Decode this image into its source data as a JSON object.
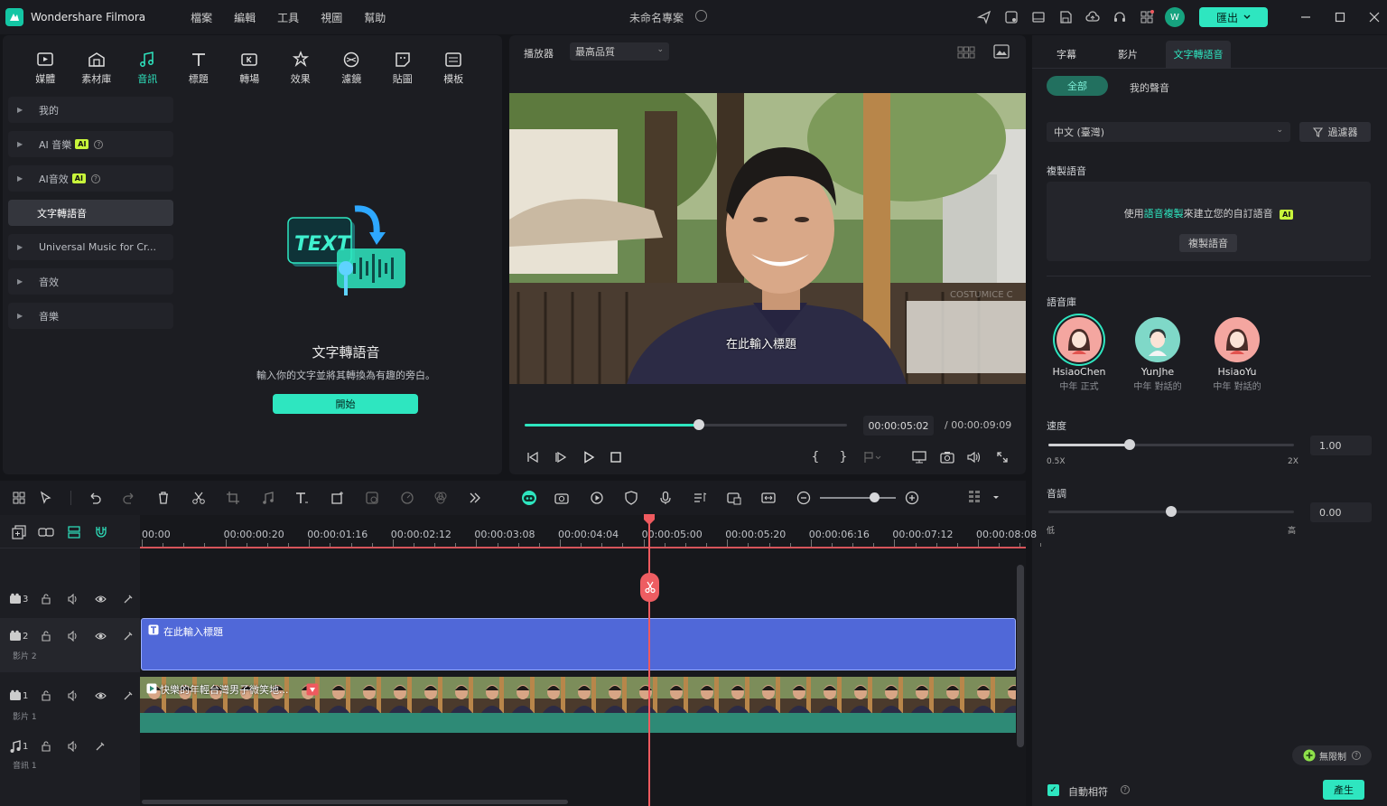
{
  "app": {
    "name": "Wondershare Filmora",
    "project_title": "未命名專案"
  },
  "menu": [
    "檔案",
    "編輯",
    "工具",
    "視圖",
    "幫助"
  ],
  "titlebar": {
    "avatar_initial": "W",
    "export_label": "匯出"
  },
  "media_tabs": [
    {
      "label": "媒體",
      "icon": "media-icon"
    },
    {
      "label": "素材庫",
      "icon": "stock-library-icon"
    },
    {
      "label": "音訊",
      "icon": "music-note-icon",
      "active": true
    },
    {
      "label": "標題",
      "icon": "title-text-icon"
    },
    {
      "label": "轉場",
      "icon": "transition-icon"
    },
    {
      "label": "效果",
      "icon": "effects-icon"
    },
    {
      "label": "濾鏡",
      "icon": "filter-icon"
    },
    {
      "label": "貼圖",
      "icon": "sticker-icon"
    },
    {
      "label": "模板",
      "icon": "template-icon"
    }
  ],
  "audio_sidebar": [
    {
      "label": "我的"
    },
    {
      "label": "AI 音樂",
      "badge": "AI"
    },
    {
      "label": "AI音效",
      "badge": "AI"
    },
    {
      "label": "文字轉語音",
      "selected": true
    },
    {
      "label": "Universal Music for Cr..."
    },
    {
      "label": "音效"
    },
    {
      "label": "音樂"
    }
  ],
  "tts_panel": {
    "illustration_text": "TEXT",
    "title": "文字轉語音",
    "description": "輸入你的文字並將其轉換為有趣的旁白。",
    "start_button": "開始"
  },
  "player": {
    "label": "播放器",
    "quality": "最高品質",
    "caption": "在此輸入標題",
    "progress_fraction": 0.54,
    "current_time": "00:00:05:02",
    "total_time": "/ 00:00:09:09",
    "watermark": "COSTUMICE C"
  },
  "right_panel": {
    "tabs": [
      "字幕",
      "影片",
      "文字轉語音"
    ],
    "active_tab": "文字轉語音",
    "filter_pills": {
      "all": "全部",
      "mine": "我的聲音"
    },
    "language": "中文 (臺灣)",
    "filter_button": "過濾器",
    "clone_section_label": "複製語音",
    "clone_desc_pre": "使用",
    "clone_desc_link": "語音複製",
    "clone_desc_post": "來建立您的自訂語音",
    "clone_badge": "AI",
    "clone_button": "複製語音",
    "voice_library_label": "語音庫",
    "voices": [
      {
        "name": "HsiaoChen",
        "desc": "中年 正式",
        "selected": true,
        "color": "#f4a6a0"
      },
      {
        "name": "YunJhe",
        "desc": "中年 對話的",
        "selected": false,
        "color": "#7fd8c8"
      },
      {
        "name": "HsiaoYu",
        "desc": "中年 對話的",
        "selected": false,
        "color": "#f4a6a0"
      }
    ],
    "speed": {
      "label": "速度",
      "value": "1.00",
      "min_label": "0.5X",
      "max_label": "2X",
      "level": 0.33
    },
    "pitch": {
      "label": "音調",
      "value": "0.00",
      "min_label": "低",
      "max_label": "高",
      "level": 0.5
    },
    "unlimited_button": "無限制",
    "auto_match_label": "自動相符",
    "auto_match_checked": true,
    "generate_button": "產生"
  },
  "timeline": {
    "ruler_labels": [
      "00:00",
      "00:00:00:20",
      "00:00:01:16",
      "00:00:02:12",
      "00:00:03:08",
      "00:00:04:04",
      "00:00:05:00",
      "00:00:05:20",
      "00:00:06:16",
      "00:00:07:12",
      "00:00:08:08"
    ],
    "tracks": [
      {
        "num": "3",
        "sub": "",
        "kind": "video"
      },
      {
        "num": "2",
        "sub": "影片 2",
        "kind": "video"
      },
      {
        "num": "1",
        "sub": "影片 1",
        "kind": "video"
      },
      {
        "num": "1",
        "sub": "音訊 1",
        "kind": "audio"
      }
    ],
    "title_clip_label": "在此輸入標題",
    "video_clip_label": "快樂的年輕台灣男子微笑地..."
  },
  "colors": {
    "accent": "#2ee6c0",
    "title_clip": "#5068d8",
    "video_clip": "#2e8a76",
    "playhead": "#ef5a5f"
  }
}
